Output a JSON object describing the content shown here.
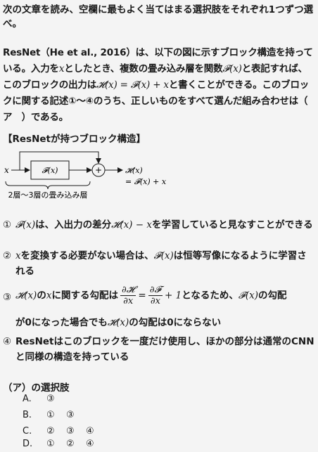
{
  "instruction": "次の文章を読み、空欄に最もよく当てはまる選択肢をそれぞれ1つずつ選べ。",
  "paragraph": {
    "p1": "ResNet（He et al., 2016）は、以下の図に示すブロック構造を持っている。入力を",
    "x": "x",
    "p2": "としたとき、複数の畳み込み層を関数",
    "Fx": "𝓕(x)",
    "p3": "と表記すれば、このブロックの出力は",
    "Hx_eq": "𝓗(x) = 𝓕(x) + x",
    "p4": "と書くことができる。このブロックに関する記述①〜④のうち、正しいものをすべて選んだ組み合わせは（　ア　）である。"
  },
  "diagram": {
    "heading": "【ResNetが持つブロック構造】",
    "input_label": "x",
    "block_label": "𝓕(x)",
    "sum_symbol": "+",
    "output_line1": "𝓗(x)",
    "output_line2": "= 𝓕(x) + x",
    "brace_label": "2層〜3層の畳み込み層"
  },
  "statements": [
    {
      "num": "①",
      "parts": [
        "𝓕(x)",
        "は、入出力の差分",
        "𝓗(x) − x",
        "を学習していると見なすことができる"
      ]
    },
    {
      "num": "②",
      "parts": [
        "x",
        "を変換する必要がない場合は、",
        "𝓕(x)",
        "は恒等写像になるように学習される"
      ]
    },
    {
      "num": "③",
      "parts": [
        "𝓗(x)",
        "の",
        "x",
        "に関する勾配は",
        "∂𝓗",
        "∂x",
        "=",
        "∂𝓕",
        "∂x",
        "+ 1",
        "となるため、",
        "𝓕(x)",
        "の勾配",
        "が0になった場合でも",
        "𝓗(x)",
        "の勾配は0にならない"
      ]
    },
    {
      "num": "④",
      "text": "ResNetはこのブロックを一度だけ使用し、ほかの部分は通常のCNNと同様の構造を持っている"
    }
  ],
  "choices": {
    "title": "（ア）の選択肢",
    "items": [
      {
        "label": "A.",
        "options": [
          "③"
        ]
      },
      {
        "label": "B.",
        "options": [
          "①",
          "③"
        ]
      },
      {
        "label": "C.",
        "options": [
          "②",
          "③",
          "④"
        ]
      },
      {
        "label": "D.",
        "options": [
          "①",
          "②",
          "④"
        ]
      }
    ]
  }
}
